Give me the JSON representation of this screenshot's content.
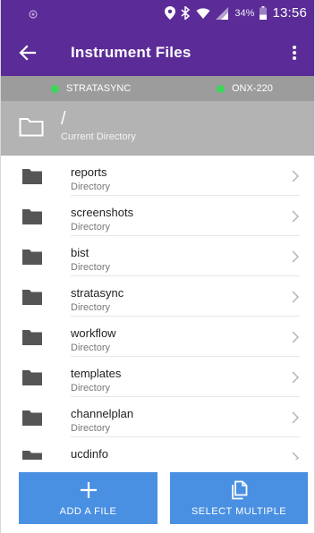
{
  "status_bar": {
    "battery_text": "34%",
    "time": "13:56"
  },
  "app_bar": {
    "title": "Instrument Files",
    "back_icon": "arrow-left-icon",
    "menu_icon": "more-vert-icon"
  },
  "connections": [
    {
      "label": "STRATASYNC",
      "status_color": "#3cd65a"
    },
    {
      "label": "ONX-220",
      "status_color": "#3cd65a"
    }
  ],
  "current_directory": {
    "path": "/",
    "subtitle": "Current Directory"
  },
  "files": [
    {
      "name": "reports",
      "kind": "Directory"
    },
    {
      "name": "screenshots",
      "kind": "Directory"
    },
    {
      "name": "bist",
      "kind": "Directory"
    },
    {
      "name": "stratasync",
      "kind": "Directory"
    },
    {
      "name": "workflow",
      "kind": "Directory"
    },
    {
      "name": "templates",
      "kind": "Directory"
    },
    {
      "name": "channelplan",
      "kind": "Directory"
    },
    {
      "name": "ucdinfo",
      "kind": "Directory"
    }
  ],
  "actions": {
    "add_label": "ADD A FILE",
    "select_multiple_label": "SELECT MULTIPLE"
  },
  "colors": {
    "app_bar": "#5b2c97",
    "connection_bar": "#9c9c9c",
    "current_dir_bar": "#b3b3b3",
    "button": "#4a90e2"
  }
}
